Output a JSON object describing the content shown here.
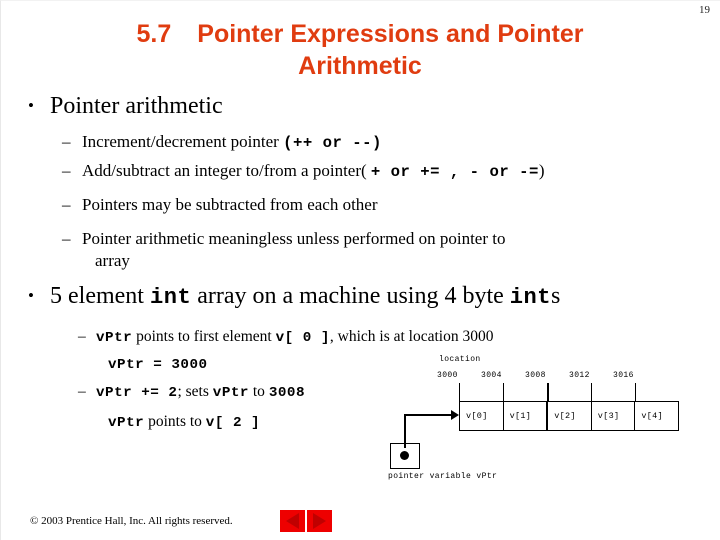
{
  "slide": {
    "page_number": "19",
    "title": {
      "number": "5.7",
      "line1": "Pointer Expressions and Pointer",
      "line2": "Arithmetic",
      "color": "#e03c10"
    },
    "bullets": {
      "b1": "Pointer arithmetic",
      "b1_sub": [
        {
          "text_before": "Increment/decrement pointer  ",
          "code": "(++ or --)",
          "text_after": ""
        },
        {
          "text_before": "Add/subtract an integer to/from a pointer( ",
          "code": "+ or += , - or -=",
          "text_after": ")"
        },
        {
          "text_before": "Pointers may be subtracted from each other",
          "code": "",
          "text_after": ""
        },
        {
          "text_before": "Pointer arithmetic meaningless unless performed on pointer to",
          "code": "",
          "text_after": ""
        }
      ],
      "b1_sub4_wrap": "array",
      "b2_part1": "5 element ",
      "b2_code1": "int",
      "b2_part2": " array on a machine using 4 byte ",
      "b2_code2": "int",
      "b2_part3": "s",
      "b2_sub1_code1": "vPtr",
      "b2_sub1_text1": " points to first element ",
      "b2_sub1_code2": "v[ 0 ]",
      "b2_sub1_text2": ", which is at location 3000",
      "b2_sub1_cont": "vPtr = 3000",
      "b2_sub2_code1": "vPtr += 2",
      "b2_sub2_text1": "; sets ",
      "b2_sub2_code2": "vPtr",
      "b2_sub2_text2": " to ",
      "b2_sub2_code3": "3008",
      "b2_sub2_cont_code1": "vPtr",
      "b2_sub2_cont_text": " points to ",
      "b2_sub2_cont_code2": "v[ 2 ]"
    },
    "diagram": {
      "location_label": "location",
      "addresses": [
        "3000",
        "3004",
        "3008",
        "3012",
        "3016"
      ],
      "cells": [
        "v[0]",
        "v[1]",
        "v[2]",
        "v[3]",
        "v[4]"
      ],
      "pointer_label": "pointer variable vPtr"
    },
    "footer": {
      "copyright": "© 2003 Prentice Hall, Inc.  All rights reserved.",
      "prev_icon": "triangle-left-icon",
      "next_icon": "triangle-right-icon",
      "button_color": "#ee0000"
    }
  }
}
